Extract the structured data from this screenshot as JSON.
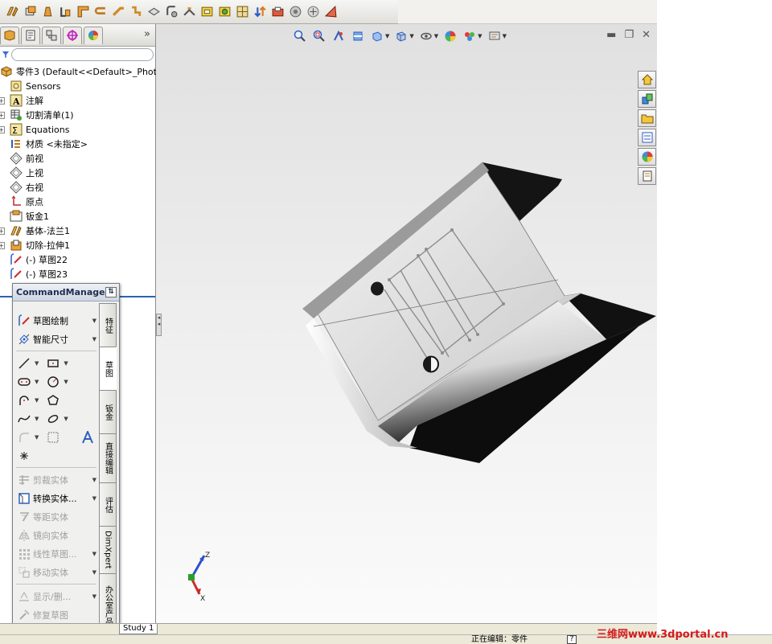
{
  "tree": {
    "root_label": "零件3  (Default<<Default>_Phot",
    "items": [
      {
        "label": "Sensors",
        "icon": "sensor-icon",
        "expandable": false
      },
      {
        "label": "注解",
        "icon": "annotation-icon",
        "expandable": true
      },
      {
        "label": "切割清单(1)",
        "icon": "cut-list-icon",
        "expandable": true
      },
      {
        "label": "Equations",
        "icon": "equations-icon",
        "expandable": true
      },
      {
        "label": "材质 <未指定>",
        "icon": "material-icon",
        "expandable": false
      },
      {
        "label": "前视",
        "icon": "plane-icon",
        "expandable": false
      },
      {
        "label": "上视",
        "icon": "plane-icon",
        "expandable": false
      },
      {
        "label": "右视",
        "icon": "plane-icon",
        "expandable": false
      },
      {
        "label": "原点",
        "icon": "origin-icon",
        "expandable": false
      },
      {
        "label": "钣金1",
        "icon": "sheet-metal-icon",
        "expandable": false
      },
      {
        "label": "基体-法兰1",
        "icon": "base-flange-icon",
        "expandable": true
      },
      {
        "label": "切除-拉伸1",
        "icon": "cut-extrude-icon",
        "expandable": true
      },
      {
        "label": "(-) 草图22",
        "icon": "sketch-icon",
        "expandable": false
      },
      {
        "label": "(-) 草图23",
        "icon": "sketch-icon",
        "expandable": false
      }
    ]
  },
  "command_manager": {
    "title": "CommandManager",
    "items": [
      {
        "label": "草图绘制",
        "icon": "sketch-icon",
        "disabled": false
      },
      {
        "label": "智能尺寸",
        "icon": "smart-dimension-icon",
        "disabled": false
      },
      {
        "label": "剪裁实体",
        "icon": "trim-icon",
        "disabled": true
      },
      {
        "label": "转换实体...",
        "icon": "convert-entities-icon",
        "disabled": false
      },
      {
        "label": "等距实体",
        "icon": "offset-icon",
        "disabled": true
      },
      {
        "label": "镜向实体",
        "icon": "mirror-icon",
        "disabled": true
      },
      {
        "label": "线性草图...",
        "icon": "linear-pattern-icon",
        "disabled": true
      },
      {
        "label": "移动实体",
        "icon": "move-entities-icon",
        "disabled": true
      },
      {
        "label": "显示/删...",
        "icon": "display-delete-icon",
        "disabled": true
      },
      {
        "label": "修复草图",
        "icon": "repair-sketch-icon",
        "disabled": true
      }
    ],
    "tabs": [
      "特征",
      "草图",
      "钣金",
      "直接编辑",
      "评估",
      "DimXpert",
      "办公室产品"
    ],
    "active_tab": "草图"
  },
  "bottom": {
    "study_tab": "Study 1",
    "status_text": "正在编辑：零件",
    "help": "?"
  },
  "watermark": "三维网www.3dportal.cn",
  "triad": {
    "z": "Z",
    "x": "X"
  },
  "colors": {
    "selection_blue": "#2a63b5",
    "viewport_top": "#e0e0e0",
    "viewport_bottom": "#fbfbfb",
    "watermark_red": "#d21a1a",
    "part_dark": "#141414"
  }
}
